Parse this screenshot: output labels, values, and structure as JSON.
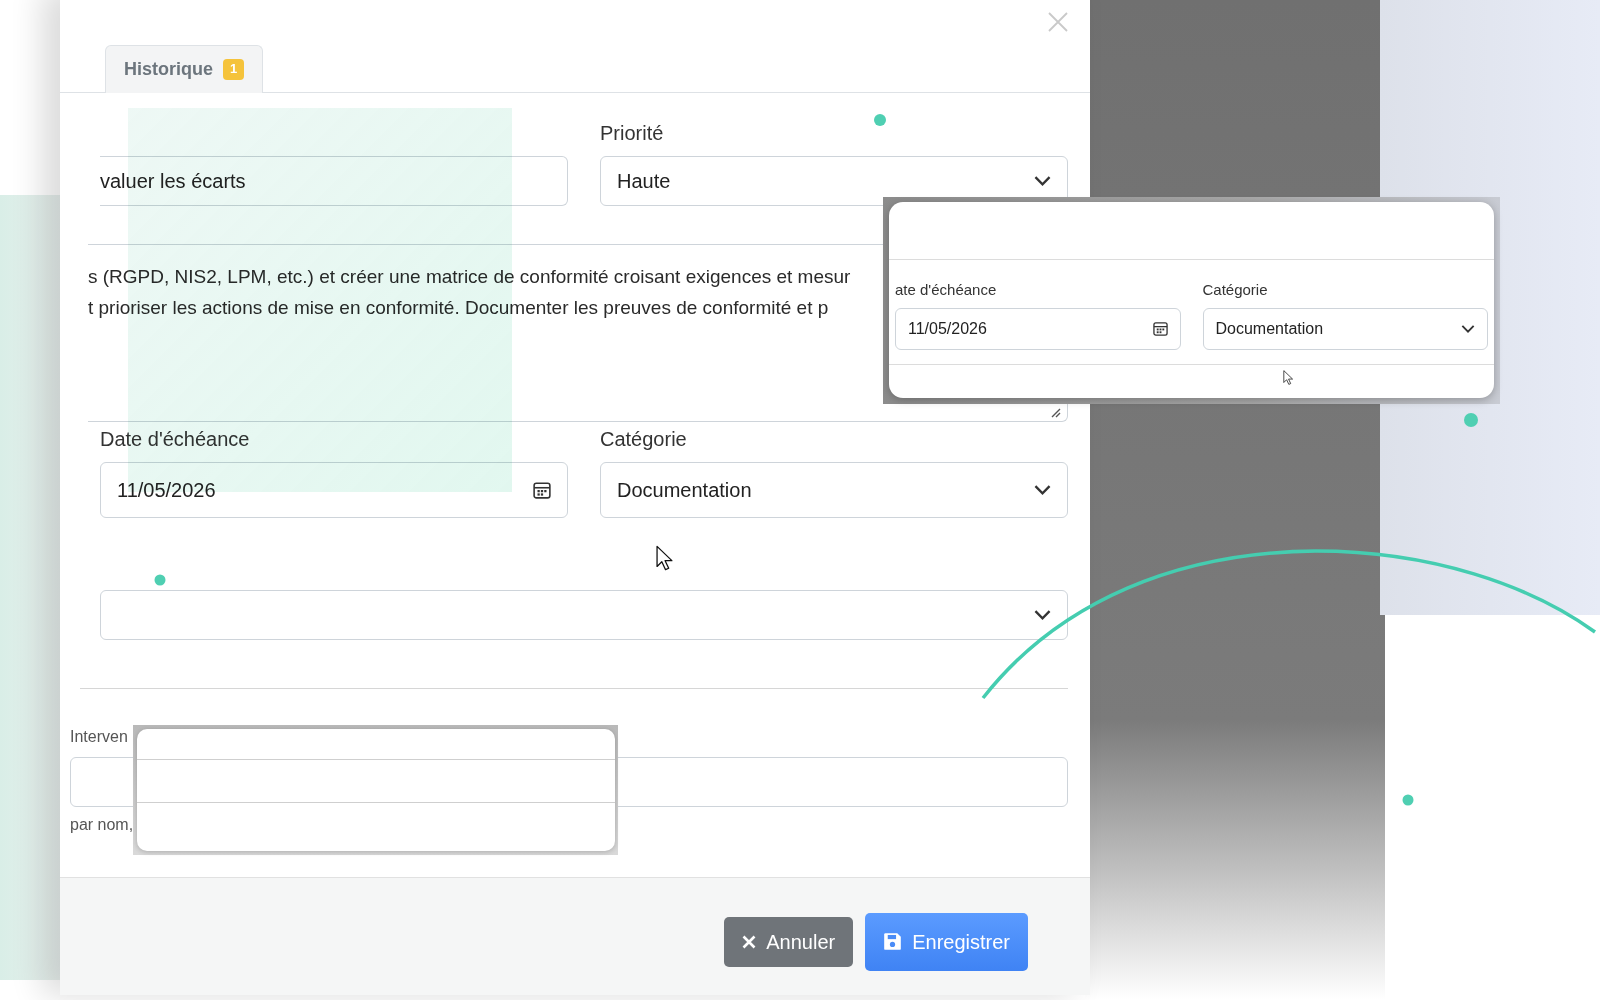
{
  "modal": {
    "tabs": [
      {
        "label": "Historique",
        "badge": "1",
        "selected": true
      }
    ],
    "rows": [
      [
        {
          "kind": "text",
          "value": "valuer les écarts"
        },
        {
          "kind": "select",
          "label": "Priorité",
          "value": "Haute"
        }
      ],
      [
        {
          "kind": "textarea",
          "value": "s (RGPD, NIS2, LPM, etc.) et créer une matrice de conformité croisant exigences et mesur\nt prioriser les actions de mise en conformité. Documenter les preuves de conformité et p"
        }
      ],
      [
        {
          "kind": "date",
          "label": "Date d'échéance",
          "value": "11/05/2026"
        },
        {
          "kind": "select",
          "label": "Catégorie",
          "value": "Documentation"
        }
      ],
      [
        {
          "kind": "select"
        }
      ],
      [
        {
          "kind": "search",
          "label": "Interven",
          "hint": "par nom,"
        }
      ]
    ],
    "buttons": [
      {
        "kind": "cancel",
        "label": "Annuler"
      },
      {
        "kind": "save",
        "label": "Enregistrer"
      }
    ]
  },
  "inset": {
    "fields": [
      {
        "kind": "date",
        "label": "ate d'échéance",
        "value": "11/05/2026"
      },
      {
        "kind": "select",
        "label": "Catégorie",
        "value": "Documentation"
      }
    ]
  }
}
